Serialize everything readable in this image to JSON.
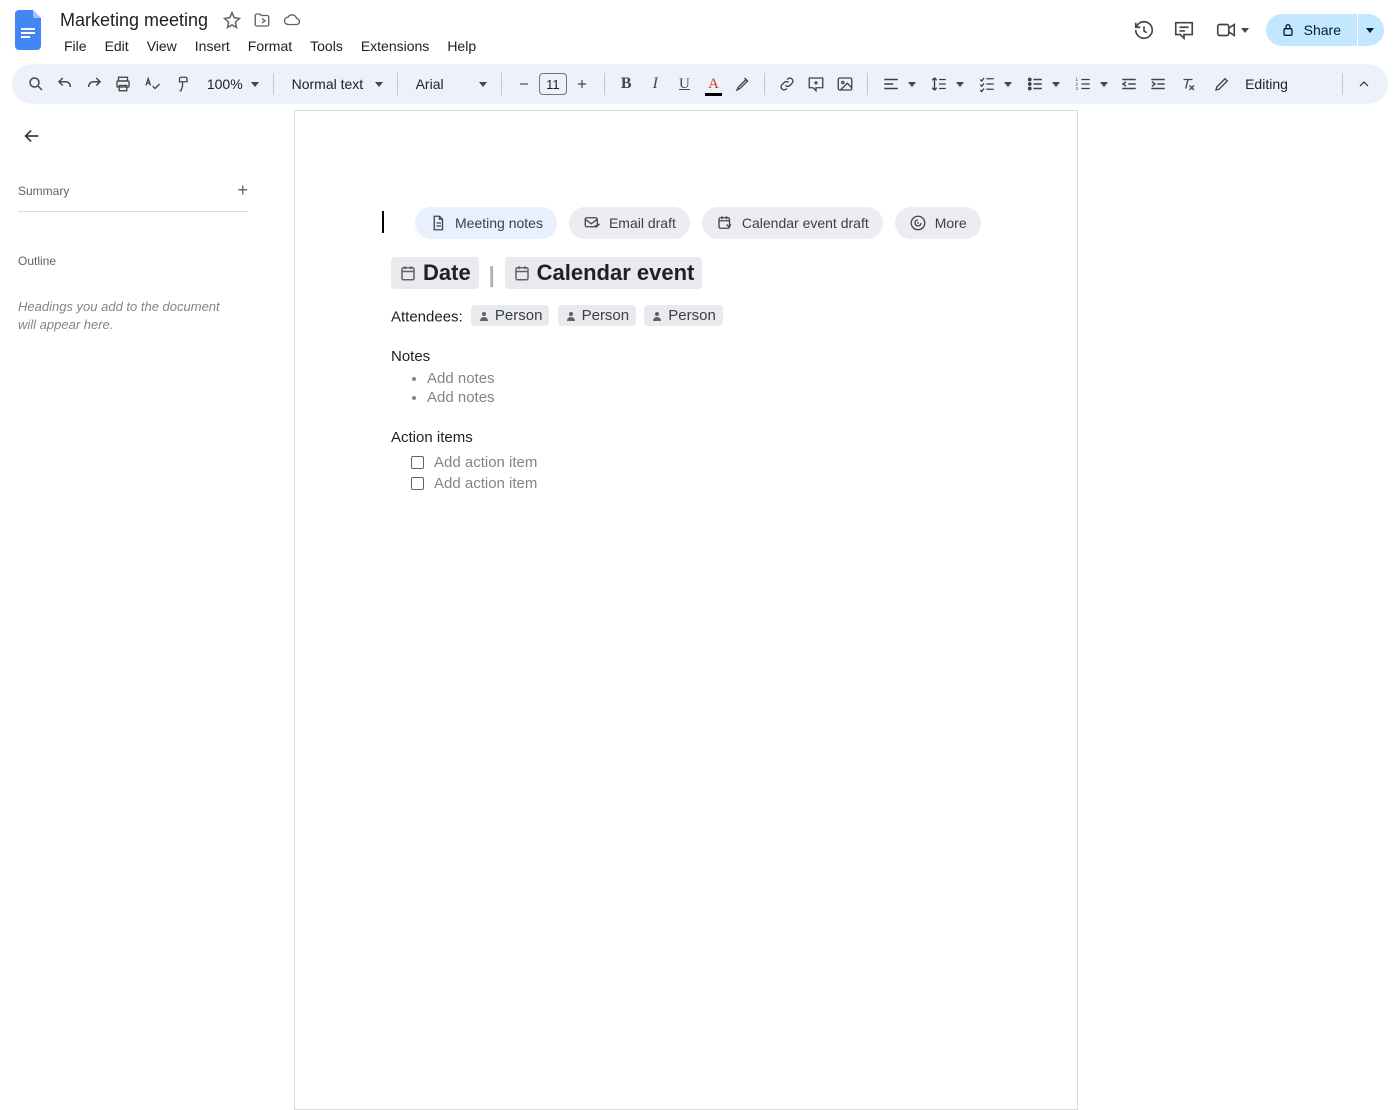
{
  "header": {
    "title": "Marketing meeting",
    "menus": [
      "File",
      "Edit",
      "View",
      "Insert",
      "Format",
      "Tools",
      "Extensions",
      "Help"
    ],
    "share_label": "Share"
  },
  "toolbar": {
    "zoom": "100%",
    "style": "Normal text",
    "font": "Arial",
    "font_size": "11",
    "mode_label": "Editing"
  },
  "sidebar": {
    "summary_label": "Summary",
    "outline_label": "Outline",
    "outline_hint": "Headings you add to the document will appear here."
  },
  "chips": {
    "meeting_notes": "Meeting notes",
    "email_draft": "Email draft",
    "calendar_event_draft": "Calendar event draft",
    "more": "More"
  },
  "doc": {
    "date_chip": "Date",
    "calendar_chip": "Calendar event",
    "attendees_label": "Attendees:",
    "persons": [
      "Person",
      "Person",
      "Person"
    ],
    "notes_heading": "Notes",
    "notes_items": [
      "Add notes",
      "Add notes"
    ],
    "actions_heading": "Action items",
    "actions_items": [
      "Add action item",
      "Add action item"
    ]
  }
}
